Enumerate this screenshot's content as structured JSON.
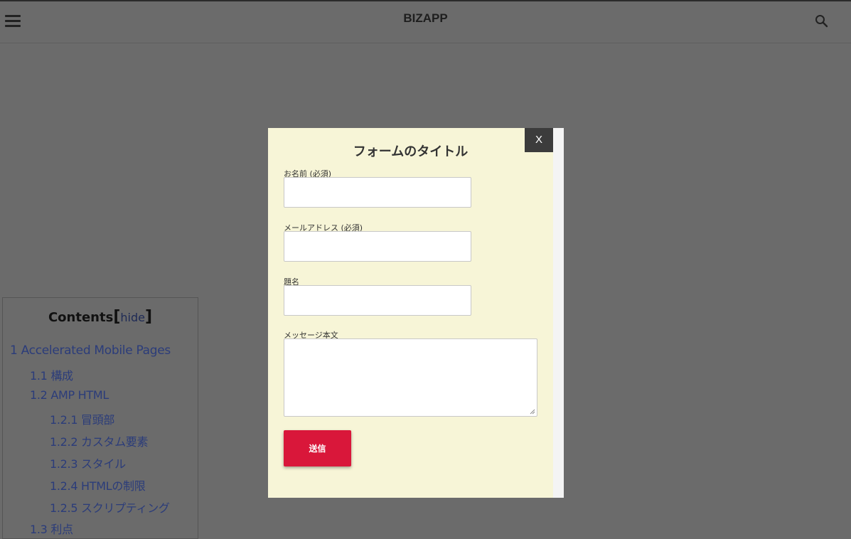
{
  "header": {
    "brand": "BIZAPP",
    "menu_icon": "hamburger-menu-icon",
    "search_icon": "search-icon"
  },
  "toc": {
    "title": "Contents",
    "bracket_open": "[",
    "hide_label": "hide",
    "bracket_close": "]",
    "items": [
      {
        "label": "1 Accelerated Mobile Pages",
        "level": 1
      },
      {
        "label": "1.1 構成",
        "level": 2
      },
      {
        "label": "1.2 AMP HTML",
        "level": 2
      },
      {
        "label": "1.2.1 冒頭部",
        "level": 3
      },
      {
        "label": "1.2.2 カスタム要素",
        "level": 3
      },
      {
        "label": "1.2.3 スタイル",
        "level": 3
      },
      {
        "label": "1.2.4 HTMLの制限",
        "level": 3
      },
      {
        "label": "1.2.5 スクリプティング",
        "level": 3
      },
      {
        "label": "1.3 利点",
        "level": 2
      }
    ]
  },
  "modal": {
    "close_label": "X",
    "title": "フォームのタイトル",
    "fields": [
      {
        "label": "お名前 (必須)",
        "value": ""
      },
      {
        "label": "メールアドレス (必須)",
        "value": ""
      },
      {
        "label": "題名",
        "value": ""
      }
    ],
    "message_label": "メッセージ本文",
    "message_value": "",
    "submit_label": "送信"
  },
  "colors": {
    "overlay": "#6b6b6b",
    "modal_bg": "#f7f5d7",
    "submit_bg": "#d9173a",
    "toc_link": "#2b3c7a"
  }
}
